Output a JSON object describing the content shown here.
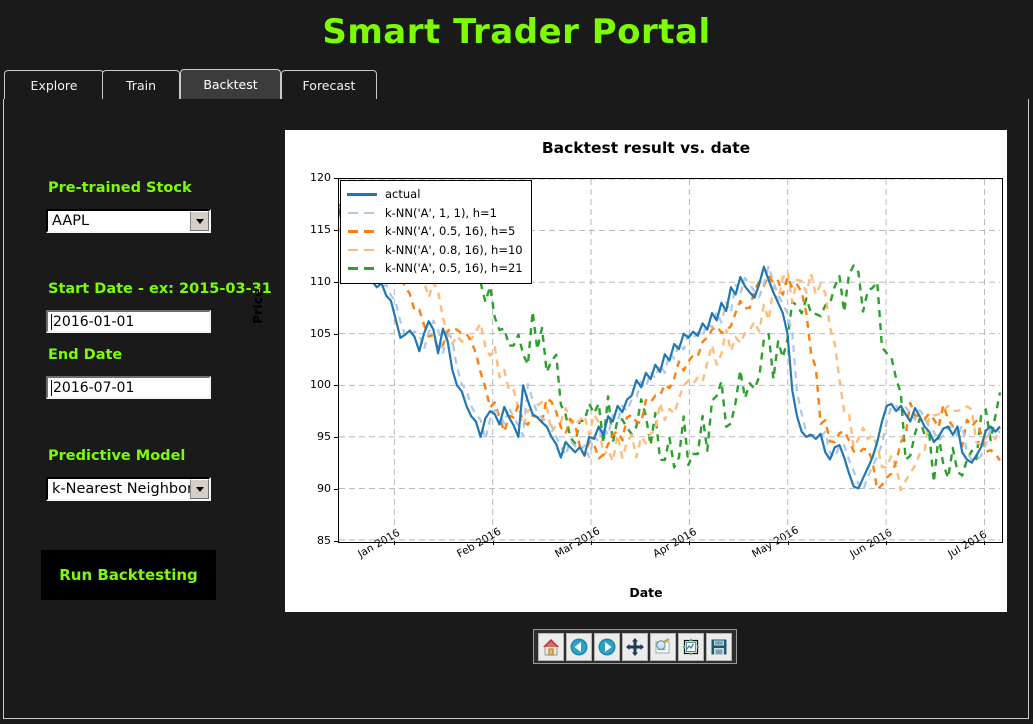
{
  "app": {
    "title": "Smart Trader Portal",
    "accent": "#7CFC00",
    "bg": "#1a1a1a"
  },
  "tabs": [
    {
      "label": "Explore",
      "active": false
    },
    {
      "label": "Train",
      "active": false
    },
    {
      "label": "Backtest",
      "active": true
    },
    {
      "label": "Forecast",
      "active": false
    }
  ],
  "sidebar": {
    "stock_label": "Pre-trained Stock",
    "stock_value": "AAPL",
    "start_label": "Start Date - ex: 2015-03-31",
    "start_value": "2016-01-01",
    "end_label": "End Date",
    "end_value": "2016-07-01",
    "model_label": "Predictive Model",
    "model_value": "k-Nearest Neighbors",
    "run_label": "Run Backtesting"
  },
  "toolbar": {
    "buttons": [
      {
        "name": "home-icon",
        "tip": "Home"
      },
      {
        "name": "back-arrow-icon",
        "tip": "Back"
      },
      {
        "name": "forward-arrow-icon",
        "tip": "Forward"
      },
      {
        "name": "pan-move-icon",
        "tip": "Pan"
      },
      {
        "name": "zoom-rect-icon",
        "tip": "Zoom to rectangle"
      },
      {
        "name": "configure-subplots-icon",
        "tip": "Configure subplots"
      },
      {
        "name": "save-floppy-icon",
        "tip": "Save figure"
      }
    ]
  },
  "chart_data": {
    "type": "line",
    "title": "Backtest result vs. date",
    "xlabel": "Date",
    "ylabel": "Price",
    "grid": true,
    "legend_position": "upper left",
    "ylim": [
      85,
      120
    ],
    "yticks": [
      85,
      90,
      95,
      100,
      105,
      110,
      115,
      120
    ],
    "xticks": [
      "Jan 2016",
      "Feb 2016",
      "Mar 2016",
      "Apr 2016",
      "May 2016",
      "Jun 2016",
      "Jul 2016"
    ],
    "xlim": [
      "2015-12-18",
      "2016-07-05"
    ],
    "series": [
      {
        "name": "actual",
        "color": "#1f77b4",
        "style": "solid",
        "values": [
          117.0,
          115.6,
          115.0,
          116.4,
          114.5,
          113.0,
          112.3,
          110.1,
          109.5,
          109.9,
          108.7,
          108.2,
          106.4,
          104.6,
          104.9,
          105.3,
          104.7,
          103.3,
          105.0,
          106.2,
          105.4,
          103.1,
          105.5,
          104.3,
          101.5,
          100.0,
          99.4,
          98.0,
          97.0,
          96.5,
          95.0,
          96.8,
          97.5,
          97.2,
          96.2,
          97.9,
          96.9,
          96.1,
          95.0,
          100.0,
          98.5,
          97.2,
          96.9,
          96.4,
          96.0,
          95.0,
          94.3,
          93.0,
          94.5,
          94.0,
          93.5,
          94.0,
          93.2,
          95.0,
          94.8,
          96.0,
          95.2,
          97.0,
          96.5,
          98.0,
          97.4,
          98.6,
          99.0,
          100.5,
          99.8,
          101.2,
          100.6,
          102.0,
          101.3,
          103.0,
          102.4,
          104.0,
          103.5,
          105.0,
          104.6,
          105.2,
          104.8,
          106.0,
          105.4,
          107.0,
          106.3,
          108.0,
          107.2,
          109.5,
          108.8,
          110.5,
          109.6,
          109.0,
          108.5,
          109.8,
          111.5,
          110.2,
          109.0,
          108.0,
          107.0,
          105.0,
          99.5,
          97.0,
          95.5,
          95.0,
          95.2,
          94.8,
          95.3,
          93.5,
          92.8,
          94.0,
          94.2,
          93.0,
          91.5,
          90.2,
          90.0,
          91.0,
          92.0,
          93.0,
          94.5,
          96.5,
          98.0,
          98.2,
          97.5,
          98.0,
          97.2,
          96.5,
          97.8,
          97.0,
          96.0,
          95.5,
          94.5,
          95.0,
          95.8,
          96.0,
          95.2,
          96.0,
          93.5,
          92.8,
          92.5,
          93.2,
          94.0,
          95.6,
          96.0,
          95.5,
          96.0
        ]
      },
      {
        "name": "k-NN('A', 1, 1), h=1",
        "color": "#aec7e8",
        "style": "dashed",
        "description": "1-step-ahead k-NN prediction, tracks actual with one-day lag"
      },
      {
        "name": "k-NN('A', 0.5, 16), h=5",
        "color": "#ff7f0e",
        "style": "dashed",
        "description": "5-day-horizon k-NN prediction"
      },
      {
        "name": "k-NN('A', 0.8, 16), h=10",
        "color": "#ffbb78",
        "style": "dashed",
        "description": "10-day-horizon k-NN prediction"
      },
      {
        "name": "k-NN('A', 0.5, 16), h=21",
        "color": "#2ca02c",
        "style": "dashed",
        "description": "21-day-horizon k-NN prediction, largest deviation from actual"
      }
    ]
  }
}
